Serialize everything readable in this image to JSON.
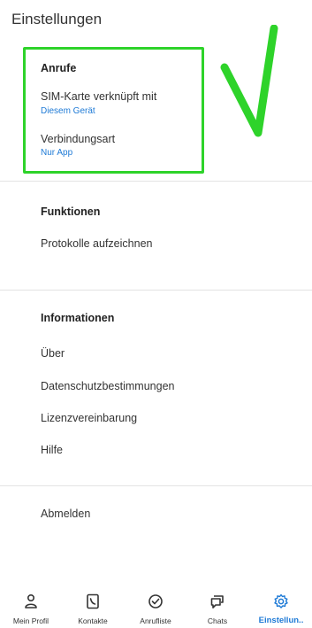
{
  "header": {
    "title": "Einstellungen"
  },
  "sections": {
    "anrufe": {
      "heading": "Anrufe",
      "sim_label": "SIM-Karte verknüpft mit",
      "sim_value": "Diesem Gerät",
      "conn_label": "Verbindungsart",
      "conn_value": "Nur App"
    },
    "funktionen": {
      "heading": "Funktionen",
      "items": [
        "Protokolle aufzeichnen"
      ]
    },
    "informationen": {
      "heading": "Informationen",
      "items": [
        "Über",
        "Datenschutzbestimmungen",
        "Lizenzvereinbarung",
        "Hilfe"
      ]
    },
    "account": {
      "logout": "Abmelden"
    }
  },
  "annotation": {
    "box_color": "#2ed32a"
  },
  "bottom_nav": {
    "items": [
      {
        "label": "Mein Profil",
        "icon": "person-icon"
      },
      {
        "label": "Kontakte",
        "icon": "contacts-book-icon"
      },
      {
        "label": "Anrufliste",
        "icon": "call-history-icon"
      },
      {
        "label": "Chats",
        "icon": "chat-bubbles-icon"
      },
      {
        "label": "Einstellun..",
        "icon": "gear-icon"
      }
    ],
    "active_index": 4,
    "accent_color": "#1e7ad6"
  }
}
